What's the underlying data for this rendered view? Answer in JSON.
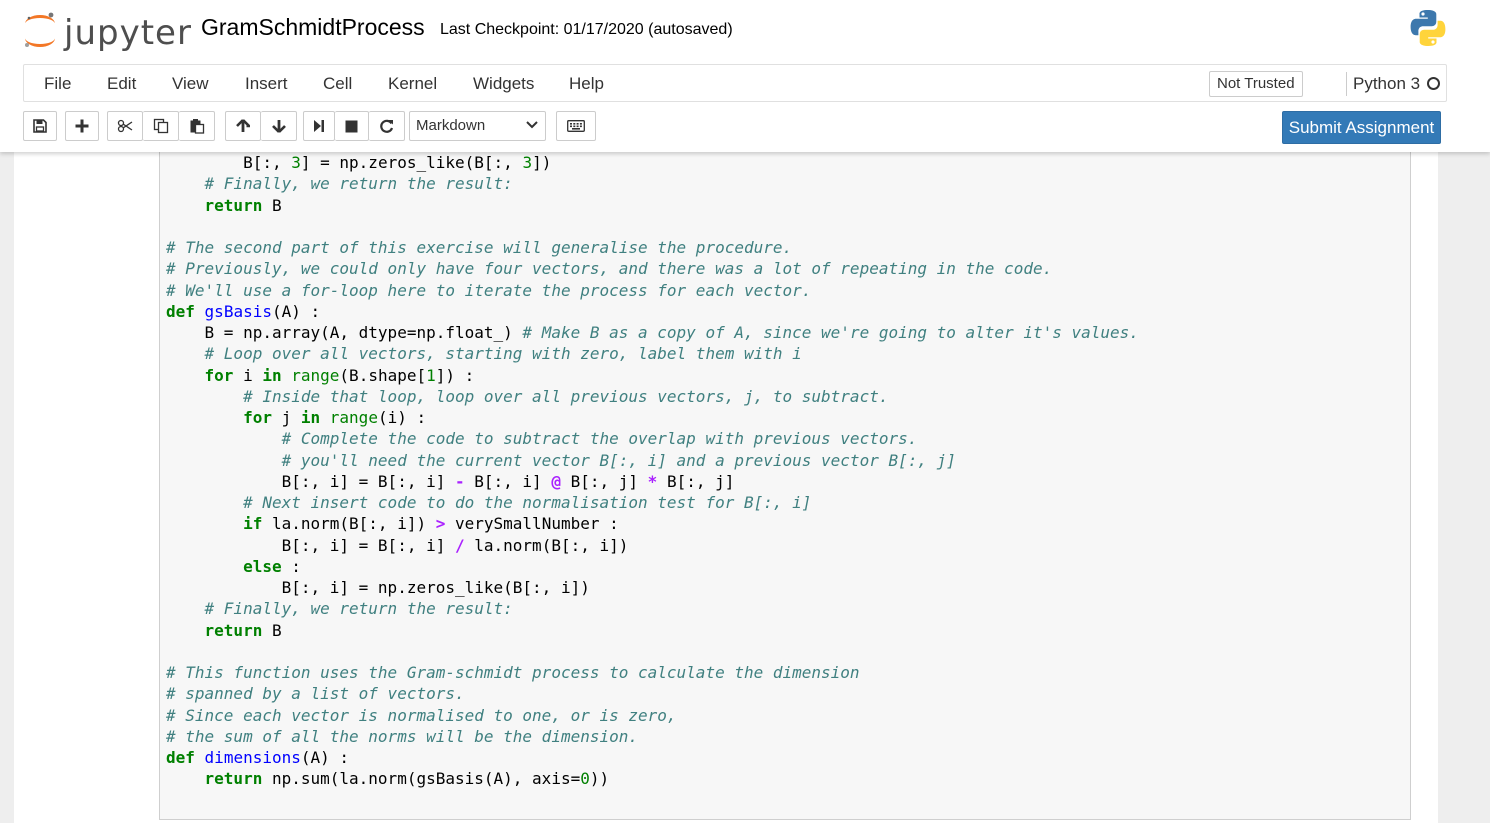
{
  "header": {
    "logo_text": "jupyter",
    "notebook_name": "GramSchmidtProcess",
    "checkpoint": "Last Checkpoint: 01/17/2020 (autosaved)"
  },
  "menubar": {
    "items": [
      "File",
      "Edit",
      "View",
      "Insert",
      "Cell",
      "Kernel",
      "Widgets",
      "Help"
    ],
    "trust_status": "Not Trusted",
    "kernel_name": "Python 3"
  },
  "toolbar": {
    "cell_type": "Markdown",
    "submit_label": "Submit Assignment",
    "icons": [
      "save-icon",
      "plus-icon",
      "cut-icon",
      "copy-icon",
      "paste-icon",
      "arrow-up-icon",
      "arrow-down-icon",
      "run-icon",
      "stop-icon",
      "restart-icon",
      "keyboard-icon"
    ]
  },
  "code_cell": {
    "lines": [
      [
        [
          "",
          "        B[:, "
        ],
        [
          "n",
          "3"
        ],
        [
          "",
          "] = np.zeros_like(B[:, "
        ],
        [
          "n",
          "3"
        ],
        [
          "",
          "])"
        ]
      ],
      [
        [
          "",
          "    "
        ],
        [
          "c",
          "# Finally, we return the result:"
        ]
      ],
      [
        [
          "",
          "    "
        ],
        [
          "k",
          "return"
        ],
        [
          "",
          " B"
        ]
      ],
      [
        [
          "",
          ""
        ]
      ],
      [
        [
          "c",
          "# The second part of this exercise will generalise the procedure."
        ]
      ],
      [
        [
          "c",
          "# Previously, we could only have four vectors, and there was a lot of repeating in the code."
        ]
      ],
      [
        [
          "c",
          "# We'll use a for-loop here to iterate the process for each vector."
        ]
      ],
      [
        [
          "k",
          "def"
        ],
        [
          "",
          " "
        ],
        [
          "f",
          "gsBasis"
        ],
        [
          "",
          "(A) :"
        ]
      ],
      [
        [
          "",
          "    B = np.array(A, dtype=np.float_) "
        ],
        [
          "c",
          "# Make B as a copy of A, since we're going to alter it's values."
        ]
      ],
      [
        [
          "",
          "    "
        ],
        [
          "c",
          "# Loop over all vectors, starting with zero, label them with i"
        ]
      ],
      [
        [
          "",
          "    "
        ],
        [
          "k",
          "for"
        ],
        [
          "",
          " i "
        ],
        [
          "k",
          "in"
        ],
        [
          "",
          " "
        ],
        [
          "b",
          "range"
        ],
        [
          "",
          "(B.shape["
        ],
        [
          "n",
          "1"
        ],
        [
          "",
          "]) :"
        ]
      ],
      [
        [
          "",
          "        "
        ],
        [
          "c",
          "# Inside that loop, loop over all previous vectors, j, to subtract."
        ]
      ],
      [
        [
          "",
          "        "
        ],
        [
          "k",
          "for"
        ],
        [
          "",
          " j "
        ],
        [
          "k",
          "in"
        ],
        [
          "",
          " "
        ],
        [
          "b",
          "range"
        ],
        [
          "",
          "(i) :"
        ]
      ],
      [
        [
          "",
          "            "
        ],
        [
          "c",
          "# Complete the code to subtract the overlap with previous vectors."
        ]
      ],
      [
        [
          "",
          "            "
        ],
        [
          "c",
          "# you'll need the current vector B[:, i] and a previous vector B[:, j]"
        ]
      ],
      [
        [
          "",
          "            B[:, i] = B[:, i] "
        ],
        [
          "o",
          "-"
        ],
        [
          "",
          " B[:, i] "
        ],
        [
          "o",
          "@"
        ],
        [
          "",
          " B[:, j] "
        ],
        [
          "o",
          "*"
        ],
        [
          "",
          " B[:, j]"
        ]
      ],
      [
        [
          "",
          "        "
        ],
        [
          "c",
          "# Next insert code to do the normalisation test for B[:, i]"
        ]
      ],
      [
        [
          "",
          "        "
        ],
        [
          "k",
          "if"
        ],
        [
          "",
          " la.norm(B[:, i]) "
        ],
        [
          "o",
          ">"
        ],
        [
          "",
          " verySmallNumber :"
        ]
      ],
      [
        [
          "",
          "            B[:, i] = B[:, i] "
        ],
        [
          "o",
          "/"
        ],
        [
          "",
          " la.norm(B[:, i])"
        ]
      ],
      [
        [
          "",
          "        "
        ],
        [
          "k",
          "else"
        ],
        [
          "",
          " :"
        ]
      ],
      [
        [
          "",
          "            B[:, i] = np.zeros_like(B[:, i])"
        ]
      ],
      [
        [
          "",
          "    "
        ],
        [
          "c",
          "# Finally, we return the result:"
        ]
      ],
      [
        [
          "",
          "    "
        ],
        [
          "k",
          "return"
        ],
        [
          "",
          " B"
        ]
      ],
      [
        [
          "",
          ""
        ]
      ],
      [
        [
          "c",
          "# This function uses the Gram-schmidt process to calculate the dimension"
        ]
      ],
      [
        [
          "c",
          "# spanned by a list of vectors."
        ]
      ],
      [
        [
          "c",
          "# Since each vector is normalised to one, or is zero,"
        ]
      ],
      [
        [
          "c",
          "# the sum of all the norms will be the dimension."
        ]
      ],
      [
        [
          "k",
          "def"
        ],
        [
          "",
          " "
        ],
        [
          "f",
          "dimensions"
        ],
        [
          "",
          "(A) :"
        ]
      ],
      [
        [
          "",
          "    "
        ],
        [
          "k",
          "return"
        ],
        [
          "",
          " np.sum(la.norm(gsBasis(A), axis="
        ],
        [
          "n",
          "0"
        ],
        [
          "",
          "))"
        ]
      ]
    ]
  }
}
